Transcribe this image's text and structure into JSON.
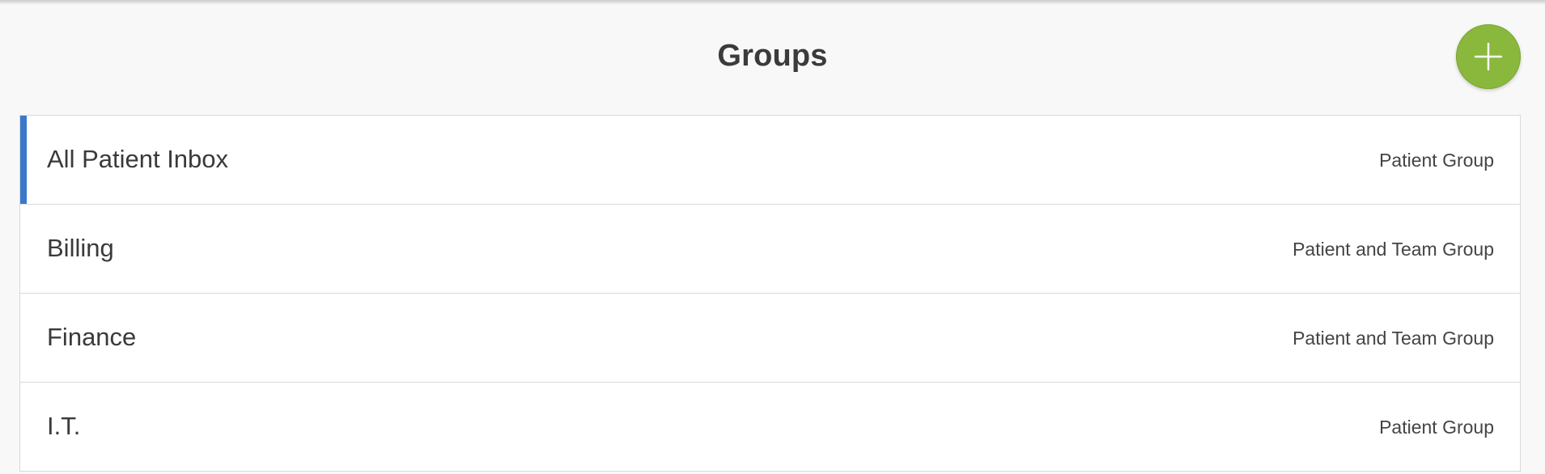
{
  "header": {
    "title": "Groups",
    "add_icon": "plus-icon",
    "add_button_color": "#8ab83c"
  },
  "groups": [
    {
      "name": "All Patient Inbox",
      "type": "Patient Group",
      "selected": true
    },
    {
      "name": "Billing",
      "type": "Patient and Team Group",
      "selected": false
    },
    {
      "name": "Finance",
      "type": "Patient and Team Group",
      "selected": false
    },
    {
      "name": "I.T.",
      "type": "Patient Group",
      "selected": false
    }
  ],
  "colors": {
    "selected_accent": "#3a78c9",
    "background": "#f8f8f8",
    "row_border": "#d9d9d9"
  }
}
